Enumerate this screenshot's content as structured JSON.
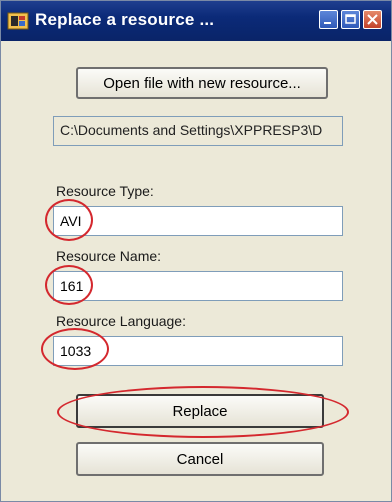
{
  "window": {
    "title": "Replace a resource ...",
    "controls": [
      "minimize-icon",
      "maximize-icon",
      "close-icon"
    ]
  },
  "open_button": {
    "label": "Open file with new resource..."
  },
  "file_path": {
    "value": "C:\\Documents and Settings\\XPPRESP3\\D"
  },
  "fields": {
    "resource_type": {
      "label": "Resource Type:",
      "value": "AVI"
    },
    "resource_name": {
      "label": "Resource Name:",
      "value": "161"
    },
    "resource_language": {
      "label": "Resource Language:",
      "value": "1033"
    }
  },
  "buttons": {
    "replace": "Replace",
    "cancel": "Cancel"
  },
  "colors": {
    "title_bar": "#0a2468",
    "highlight_ovals": "#d4282e",
    "dialog_bg": "#ece9d8"
  }
}
